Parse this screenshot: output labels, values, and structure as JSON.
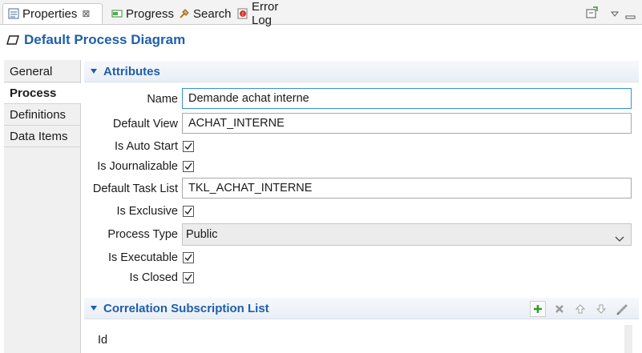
{
  "tabs": [
    {
      "label": "Properties",
      "close": "⊠",
      "icon": "properties-icon"
    },
    {
      "label": "Progress",
      "icon": "progress-icon"
    },
    {
      "label": "Search",
      "icon": "search-icon"
    },
    {
      "label": "Error Log",
      "icon": "error-log-icon"
    }
  ],
  "header": {
    "title": "Default Process Diagram",
    "icon": "diagram-icon"
  },
  "nav": [
    "General",
    "Process",
    "Definitions",
    "Data Items"
  ],
  "nav_selected": "Process",
  "sections": {
    "attributes": "Attributes",
    "correlation": "Correlation Subscription List"
  },
  "fields": {
    "name": {
      "label": "Name",
      "value": "Demande achat interne"
    },
    "default_view": {
      "label": "Default View",
      "value": "ACHAT_INTERNE"
    },
    "is_auto_start": {
      "label": "Is Auto Start",
      "checked": true
    },
    "is_journalizable": {
      "label": "Is Journalizable",
      "checked": true
    },
    "default_task_list": {
      "label": "Default Task List",
      "value": "TKL_ACHAT_INTERNE"
    },
    "is_exclusive": {
      "label": "Is Exclusive",
      "checked": true
    },
    "process_type": {
      "label": "Process Type",
      "value": "Public"
    },
    "is_executable": {
      "label": "Is Executable",
      "checked": true
    },
    "is_closed": {
      "label": "Is Closed",
      "checked": true
    }
  },
  "correlation": {
    "column_id": "Id"
  },
  "colors": {
    "accent": "#1f5fa8",
    "add_green": "#2e9b2e"
  }
}
